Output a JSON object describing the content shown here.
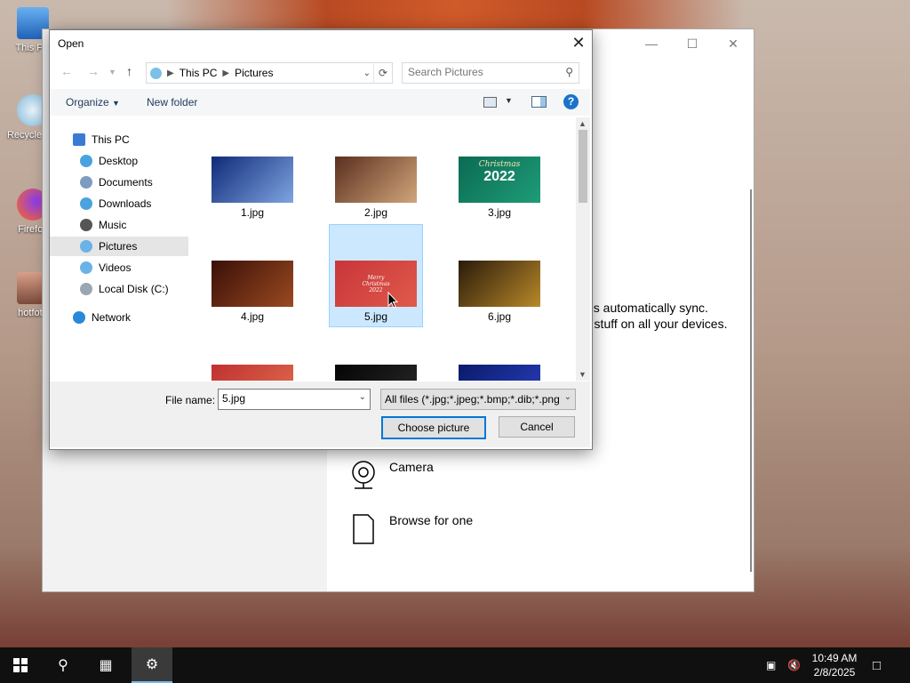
{
  "desktop": {
    "icons": [
      {
        "label": "This PC",
        "icon": "this-pc-icon"
      },
      {
        "label": "Recycle Bin",
        "icon": "recycle-bin-icon"
      },
      {
        "label": "Firefox",
        "icon": "firefox-icon"
      },
      {
        "label": "hotfoto",
        "icon": "photo-file-icon"
      }
    ]
  },
  "settings_window": {
    "sync_text_1": "es automatically sync.",
    "sync_text_2": "r stuff on all your devices.",
    "options": [
      {
        "label": "Camera",
        "icon": "camera-icon"
      },
      {
        "label": "Browse for one",
        "icon": "file-icon"
      }
    ]
  },
  "dialog": {
    "title": "Open",
    "breadcrumb": [
      "This PC",
      "Pictures"
    ],
    "search_placeholder": "Search Pictures",
    "toolbar": {
      "organize": "Organize",
      "new_folder": "New folder",
      "help": "?"
    },
    "nav": [
      {
        "label": "This PC",
        "icon": "this-pc-icon",
        "color": "#3a7bd5"
      },
      {
        "label": "Desktop",
        "icon": "desktop-icon",
        "color": "#4aa3df"
      },
      {
        "label": "Documents",
        "icon": "documents-icon",
        "color": "#7d9cc0"
      },
      {
        "label": "Downloads",
        "icon": "downloads-icon",
        "color": "#4aa3df"
      },
      {
        "label": "Music",
        "icon": "music-icon",
        "color": "#555555"
      },
      {
        "label": "Pictures",
        "icon": "pictures-icon",
        "color": "#6bb2e6"
      },
      {
        "label": "Videos",
        "icon": "videos-icon",
        "color": "#6bb2e6"
      },
      {
        "label": "Local Disk (C:)",
        "icon": "local-disk-icon",
        "color": "#9aa7b3"
      },
      {
        "label": "Network",
        "icon": "network-icon",
        "color": "#2a88d8"
      }
    ],
    "files": [
      {
        "name": "1.jpg",
        "colors": [
          "#0f2a78",
          "#7fa4e0"
        ]
      },
      {
        "name": "2.jpg",
        "colors": [
          "#5a2f1f",
          "#d1a67a"
        ]
      },
      {
        "name": "3.jpg",
        "colors": [
          "#0b6b52",
          "#1e9c78"
        ]
      },
      {
        "name": "4.jpg",
        "colors": [
          "#3a0f08",
          "#9a4a20"
        ]
      },
      {
        "name": "5.jpg",
        "colors": [
          "#c8353a",
          "#e05a4a"
        ]
      },
      {
        "name": "6.jpg",
        "colors": [
          "#2a1a0a",
          "#b8892a"
        ]
      },
      {
        "name": "",
        "colors": [
          "#c03030",
          "#e07050"
        ]
      },
      {
        "name": "",
        "colors": [
          "#050505",
          "#2a2a2a"
        ]
      },
      {
        "name": "",
        "colors": [
          "#0a1a6a",
          "#2a40c0"
        ]
      }
    ],
    "thumb_texts": {
      "f3_title": "Christmas",
      "f3_year": "2022",
      "f5_line1": "Merry",
      "f5_line2": "Christmas",
      "f5_year": "2022"
    },
    "file_name_label": "File name:",
    "file_name_value": "5.jpg",
    "filter_value": "All files (*.jpg;*.jpeg;*.bmp;*.dib;*.png",
    "choose_button": "Choose picture",
    "cancel_button": "Cancel"
  },
  "taskbar": {
    "time": "10:49 AM",
    "date": "2/8/2025"
  }
}
